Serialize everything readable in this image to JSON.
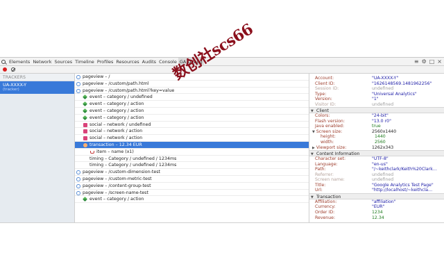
{
  "watermark": "数创社scs66",
  "toolbar": {
    "tabs": [
      "Elements",
      "Network",
      "Sources",
      "Timeline",
      "Profiles",
      "Resources",
      "Audits",
      "Console",
      "GA Debug"
    ],
    "selected_tab": 8
  },
  "left_panel": {
    "header": "TRACKERS",
    "tracker_id": "UA-XXXX-Y",
    "tracker_name": "(tracker)"
  },
  "hits": [
    {
      "type": "pageview",
      "indent": 0,
      "text": "pageview – /"
    },
    {
      "type": "pageview",
      "indent": 0,
      "text": "pageview – /custom/path.html"
    },
    {
      "type": "pageview",
      "indent": 0,
      "text": "pageview – /custom/path.html?key=value"
    },
    {
      "type": "event",
      "indent": 1,
      "text": "event – category / undefined"
    },
    {
      "type": "event",
      "indent": 1,
      "text": "event – category / action"
    },
    {
      "type": "event",
      "indent": 1,
      "text": "event – category / action"
    },
    {
      "type": "event",
      "indent": 1,
      "text": "event – category / action"
    },
    {
      "type": "social",
      "indent": 1,
      "text": "social – network / undefined"
    },
    {
      "type": "social",
      "indent": 1,
      "text": "social – network / action"
    },
    {
      "type": "social",
      "indent": 1,
      "text": "social – network / action"
    },
    {
      "type": "transaction",
      "indent": 1,
      "text": "transaction – 12.34 EUR",
      "selected": true
    },
    {
      "type": "item",
      "indent": 2,
      "text": "item – name (x1)"
    },
    {
      "type": "timing",
      "indent": 1,
      "text": "timing – Category / undefined / 1234ms"
    },
    {
      "type": "timing",
      "indent": 1,
      "text": "timing – Category / undefined / 1234ms"
    },
    {
      "type": "pageview",
      "indent": 0,
      "text": "pageview – /custom-dimension-test"
    },
    {
      "type": "pageview",
      "indent": 0,
      "text": "pageview – /custom-metric-test"
    },
    {
      "type": "pageview",
      "indent": 0,
      "text": "pageview – /content-group-test"
    },
    {
      "type": "pageview",
      "indent": 0,
      "text": "pageview – /screen-name-test"
    },
    {
      "type": "event",
      "indent": 1,
      "text": "event – category / action"
    }
  ],
  "details": [
    {
      "kind": "prop",
      "key": "Account:",
      "value": "\"UA-XXXX-Y\""
    },
    {
      "kind": "prop",
      "key": "Client ID:",
      "value": "\"1626148569.1481962256\""
    },
    {
      "kind": "prop",
      "key": "Session ID:",
      "value": "undefined",
      "style": "undef"
    },
    {
      "kind": "prop",
      "key": "Type:",
      "value": "\"Universal Analytics\""
    },
    {
      "kind": "prop",
      "key": "Version:",
      "value": "\"1\""
    },
    {
      "kind": "prop",
      "key": "Visitor ID:",
      "value": "undefined",
      "style": "undef"
    },
    {
      "kind": "section",
      "label": "Client",
      "open": true
    },
    {
      "kind": "prop",
      "key": "Colors:",
      "value": "\"24-bit\""
    },
    {
      "kind": "prop",
      "key": "Flash version:",
      "value": "\"13.0 r0\""
    },
    {
      "kind": "prop",
      "key": "Java enabled:",
      "value": "true",
      "style": "bool"
    },
    {
      "kind": "prop",
      "key": "Screen size:",
      "value": "2560x1440",
      "style": "plain",
      "group": true
    },
    {
      "kind": "prop",
      "key": "height:",
      "value": "1440",
      "style": "num",
      "sub": true
    },
    {
      "kind": "prop",
      "key": "width:",
      "value": "2560",
      "style": "num",
      "sub": true
    },
    {
      "kind": "prop",
      "key": "Viewport size:",
      "value": "1262x343",
      "style": "plain",
      "group": true,
      "collapsed": true
    },
    {
      "kind": "section",
      "label": "Content Information",
      "open": true
    },
    {
      "kind": "prop",
      "key": "Character set:",
      "value": "\"UTF-8\""
    },
    {
      "kind": "prop",
      "key": "Language:",
      "value": "\"en-us\""
    },
    {
      "kind": "prop",
      "key": "Path:",
      "value": "\"/~keithclark/Keith%20Clark…"
    },
    {
      "kind": "prop",
      "key": "Referrer:",
      "value": "undefined",
      "style": "undef"
    },
    {
      "kind": "prop",
      "key": "Screen name:",
      "value": "undefined",
      "style": "undef"
    },
    {
      "kind": "prop",
      "key": "Title:",
      "value": "\"Google Analytics Test Page\""
    },
    {
      "kind": "prop",
      "key": "Url:",
      "value": "\"http://localhost/~keithcla…"
    },
    {
      "kind": "section",
      "label": "Transaction",
      "open": true
    },
    {
      "kind": "prop",
      "key": "Affiliation:",
      "value": "\"affiliation\""
    },
    {
      "kind": "prop",
      "key": "Currency:",
      "value": "\"EUR\""
    },
    {
      "kind": "prop",
      "key": "Order ID:",
      "value": "1234",
      "style": "num"
    },
    {
      "kind": "prop",
      "key": "Revenue:",
      "value": "12.34",
      "style": "num"
    }
  ]
}
